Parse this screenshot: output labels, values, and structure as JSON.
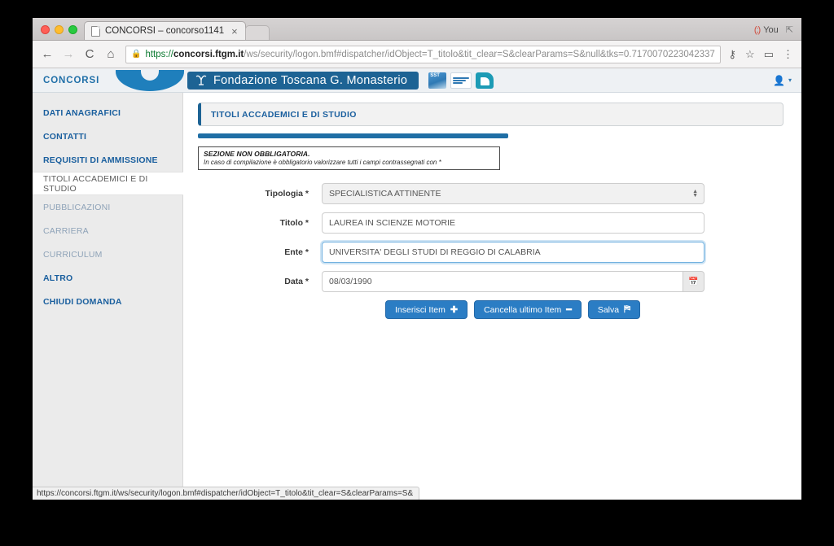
{
  "browser": {
    "tab": {
      "title": "CONCORSI – concorso1141",
      "close_label": "×",
      "favicon": "page-icon"
    },
    "nav": {
      "back": "←",
      "forward": "→",
      "reload": "C",
      "home": "⌂"
    },
    "omnibox": {
      "lock": "lock-icon",
      "scheme": "https://",
      "host": "concorsi.ftgm.it",
      "path": "/ws/security/logon.bmf#dispatcher/idObject=T_titolo&tit_clear=S&clearParams=S&null&tks=0.7170070223042337",
      "full_url": "https://concorsi.ftgm.it/ws/security/logon.bmf#dispatcher/idObject=T_titolo&tit_clear=S&clearParams=S&null&tks=0.7170070223042337"
    },
    "toolbar_icons": {
      "key": "⚷",
      "star": "☆",
      "cast": "▭",
      "menu": "⋮"
    },
    "window_controls": {
      "you_icon": "(;)",
      "you_label": "You",
      "maximize": "⇱"
    },
    "status_bar": "https://concorsi.ftgm.it/ws/security/logon.bmf#dispatcher/idObject=T_titolo&tit_clear=S&clearParams=S&"
  },
  "app_header": {
    "brand": "CONCORSI",
    "banner_title": "Fondazione Toscana G. Monasterio",
    "banner_logo": "fondazione-logo",
    "logos": [
      "sst-logo",
      "servizio-sanitario-toscana-logo",
      "teal-square-logo"
    ],
    "user_icon": "user-icon",
    "user_caret": "▾"
  },
  "sidebar": {
    "items": [
      {
        "label": "DATI ANAGRAFICI",
        "state": "strong"
      },
      {
        "label": "CONTATTI",
        "state": "strong"
      },
      {
        "label": "REQUISITI DI AMMISSIONE",
        "state": "strong"
      },
      {
        "label": "TITOLI ACCADEMICI E DI STUDIO",
        "state": "active"
      },
      {
        "label": "PUBBLICAZIONI",
        "state": "muted"
      },
      {
        "label": "CARRIERA",
        "state": "muted"
      },
      {
        "label": "CURRICULUM",
        "state": "muted"
      },
      {
        "label": "ALTRO",
        "state": "strong"
      },
      {
        "label": "CHIUDI DOMANDA",
        "state": "strong"
      }
    ]
  },
  "main": {
    "section_title": "TITOLI ACCADEMICI E DI STUDIO",
    "progress_percent": 53,
    "notice": {
      "title": "SEZIONE NON OBBLIGATORIA.",
      "text": "In caso di compilazione è obbligatorio valorizzare tutti i campi contrassegnati con *"
    },
    "fields": [
      {
        "label": "Tipologia *",
        "value": "SPECIALISTICA ATTINENTE",
        "type": "select",
        "focused": false
      },
      {
        "label": "Titolo *",
        "value": "LAUREA IN SCIENZE MOTORIE",
        "type": "text",
        "focused": false
      },
      {
        "label": "Ente *",
        "value": "UNIVERSITA' DEGLI STUDI DI REGGIO DI CALABRIA",
        "type": "text",
        "focused": true
      },
      {
        "label": "Data *",
        "value": "08/03/1990",
        "type": "date",
        "focused": false,
        "addon_icon": "calendar-icon"
      }
    ],
    "buttons": [
      {
        "label": "Inserisci Item",
        "glyph": "✚"
      },
      {
        "label": "Cancella ultimo Item",
        "glyph": "━"
      },
      {
        "label": "Salva",
        "glyph": "⛿"
      }
    ]
  },
  "colors": {
    "accent_blue": "#1d6394",
    "button_blue": "#2b7dc4",
    "link_blue": "#1a5f9e",
    "sidebar_bg": "#ebebeb"
  }
}
